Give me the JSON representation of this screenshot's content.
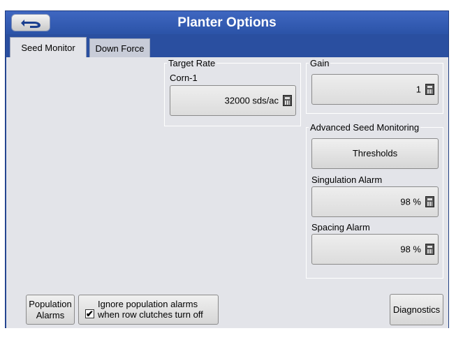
{
  "header": {
    "title": "Planter Options",
    "back_icon": "back-arrow-icon"
  },
  "tabs": [
    {
      "label": "Seed Monitor",
      "active": true
    },
    {
      "label": "Down Force",
      "active": false
    }
  ],
  "target_rate": {
    "group_title": "Target Rate",
    "product_label": "Corn-1",
    "value": "32000 sds/ac"
  },
  "gain": {
    "group_title": "Gain",
    "value": "1"
  },
  "advanced": {
    "group_title": "Advanced Seed Monitoring",
    "thresholds_label": "Thresholds",
    "singulation_label": "Singulation Alarm",
    "singulation_value": "98 %",
    "spacing_label": "Spacing Alarm",
    "spacing_value": "98 %"
  },
  "footer": {
    "population_alarms_line1": "Population",
    "population_alarms_line2": "Alarms",
    "ignore_line1": "Ignore population alarms",
    "ignore_line2": "when row clutches turn off",
    "ignore_checked": true,
    "diagnostics_label": "Diagnostics"
  }
}
